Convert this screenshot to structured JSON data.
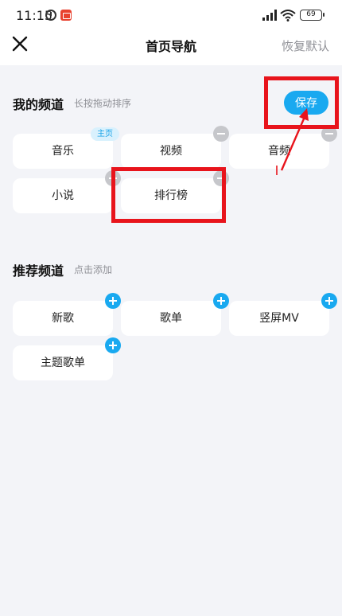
{
  "status_bar": {
    "time": "11:15",
    "battery": "69",
    "icons": [
      "alarm-icon",
      "app-badge-icon",
      "signal-icon",
      "wifi-icon",
      "battery-icon"
    ]
  },
  "header": {
    "title": "首页导航",
    "restore_label": "恢复默认",
    "close_icon": "close-icon"
  },
  "my_channels": {
    "title": "我的频道",
    "hint": "长按拖动排序",
    "save_label": "保存",
    "home_tag": "主页",
    "items": [
      {
        "label": "音乐"
      },
      {
        "label": "视频"
      },
      {
        "label": "音频"
      },
      {
        "label": "小说"
      },
      {
        "label": "排行榜"
      }
    ]
  },
  "recommended_channels": {
    "title": "推荐频道",
    "hint": "点击添加",
    "items": [
      {
        "label": "新歌"
      },
      {
        "label": "歌单"
      },
      {
        "label": "竖屏MV"
      },
      {
        "label": "主题歌单"
      }
    ]
  },
  "colors": {
    "accent": "#19a9f0",
    "annotation": "#e8141c",
    "background": "#f3f4f8"
  }
}
